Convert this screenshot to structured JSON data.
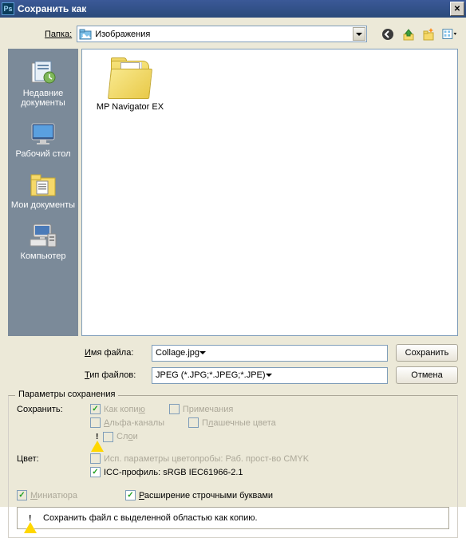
{
  "window": {
    "title": "Сохранить как"
  },
  "top": {
    "folder_label": "Папка:",
    "folder_value": "Изображения"
  },
  "sidebar": {
    "items": [
      {
        "label": "Недавние документы"
      },
      {
        "label": "Рабочий стол"
      },
      {
        "label": "Мои документы"
      },
      {
        "label": "Компьютер"
      }
    ]
  },
  "files": {
    "items": [
      {
        "name": "MP Navigator EX"
      }
    ]
  },
  "filename": {
    "label": "Имя файла:",
    "value": "Collage.jpg"
  },
  "filetype": {
    "label": "Тип файлов:",
    "value": "JPEG (*.JPG;*.JPEG;*.JPE)"
  },
  "buttons": {
    "save": "Сохранить",
    "cancel": "Отмена"
  },
  "options": {
    "group_title": "Параметры сохранения",
    "save_label": "Сохранить:",
    "as_copy": "Как копию",
    "notes": "Примечания",
    "alpha": "Альфа-каналы",
    "spot": "Плашечные цвета",
    "layers": "Слои",
    "color_label": "Цвет:",
    "proof": "Исп. параметры цветопробы:  Раб. прост-во CMYK",
    "icc": "ICC-профиль:  sRGB IEC61966-2.1",
    "thumbnail": "Миниатюра",
    "lowercase": "Расширение строчными буквами",
    "info": "Сохранить файл с выделенной областью как копию."
  }
}
